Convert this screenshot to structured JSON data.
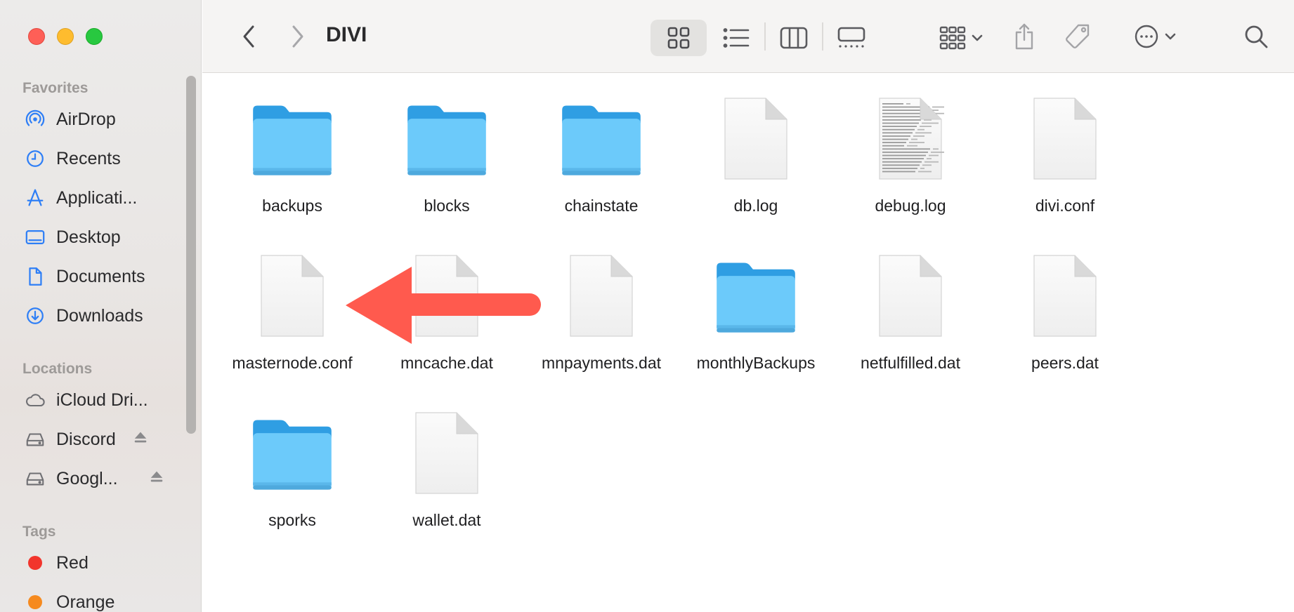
{
  "window": {
    "title": "DIVI"
  },
  "sidebar": {
    "favorites_title": "Favorites",
    "favorites": [
      {
        "label": "AirDrop",
        "icon": "airdrop-icon"
      },
      {
        "label": "Recents",
        "icon": "clock-icon"
      },
      {
        "label": "Applicati...",
        "icon": "applications-icon"
      },
      {
        "label": "Desktop",
        "icon": "desktop-icon"
      },
      {
        "label": "Documents",
        "icon": "document-icon"
      },
      {
        "label": "Downloads",
        "icon": "download-icon"
      }
    ],
    "locations_title": "Locations",
    "locations": [
      {
        "label": "iCloud Dri...",
        "icon": "cloud-icon"
      },
      {
        "label": "Discord",
        "icon": "drive-icon",
        "eject": true
      },
      {
        "label": "Googl...",
        "icon": "drive-icon",
        "eject": true
      }
    ],
    "tags_title": "Tags",
    "tags": [
      {
        "label": "Red",
        "color": "#f2352c"
      },
      {
        "label": "Orange",
        "color": "#f68a1f"
      }
    ]
  },
  "toolbar": {
    "back": "chevron-left-icon",
    "forward": "chevron-right-icon",
    "views": [
      "icon-view-icon",
      "list-view-icon",
      "column-view-icon",
      "gallery-view-icon"
    ],
    "active_view": "icon-view-icon"
  },
  "files": [
    {
      "name": "backups",
      "kind": "folder"
    },
    {
      "name": "blocks",
      "kind": "folder"
    },
    {
      "name": "chainstate",
      "kind": "folder"
    },
    {
      "name": "db.log",
      "kind": "doc"
    },
    {
      "name": "debug.log",
      "kind": "textdoc"
    },
    {
      "name": "divi.conf",
      "kind": "doc"
    },
    {
      "name": "masternode.conf",
      "kind": "doc"
    },
    {
      "name": "mncache.dat",
      "kind": "doc"
    },
    {
      "name": "mnpayments.dat",
      "kind": "doc"
    },
    {
      "name": "monthlyBackups",
      "kind": "folder"
    },
    {
      "name": "netfulfilled.dat",
      "kind": "doc"
    },
    {
      "name": "peers.dat",
      "kind": "doc"
    },
    {
      "name": "sporks",
      "kind": "folder"
    },
    {
      "name": "wallet.dat",
      "kind": "doc"
    }
  ],
  "colors": {
    "folder": "#6ccafa",
    "folder_tab": "#2f9ee3",
    "arrow": "#ff5a4e"
  }
}
